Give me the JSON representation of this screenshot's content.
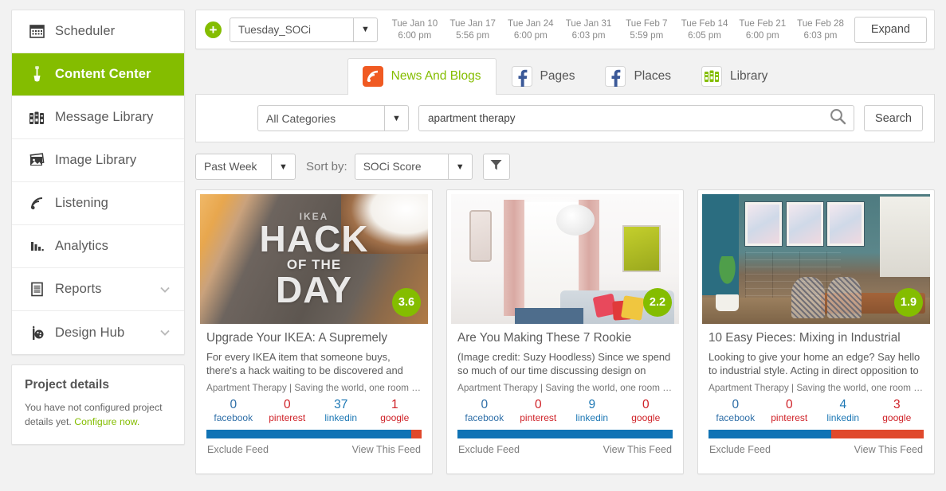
{
  "sidebar": {
    "items": [
      {
        "label": "Scheduler",
        "icon": "calendar-icon",
        "active": false,
        "expandable": false
      },
      {
        "label": "Content Center",
        "icon": "shovel-icon",
        "active": true,
        "expandable": false
      },
      {
        "label": "Message Library",
        "icon": "binders-icon",
        "active": false,
        "expandable": false
      },
      {
        "label": "Image Library",
        "icon": "photos-icon",
        "active": false,
        "expandable": false
      },
      {
        "label": "Listening",
        "icon": "rss-icon",
        "active": false,
        "expandable": false
      },
      {
        "label": "Analytics",
        "icon": "bar-chart-icon",
        "active": false,
        "expandable": false
      },
      {
        "label": "Reports",
        "icon": "document-icon",
        "active": false,
        "expandable": true
      },
      {
        "label": "Design Hub",
        "icon": "palette-brush-icon",
        "active": false,
        "expandable": true
      }
    ],
    "project_details": {
      "title": "Project details",
      "text": "You have not configured project details yet. ",
      "link": "Configure now."
    }
  },
  "toolbar": {
    "add_label": "+",
    "project_select": "Tuesday_SOCi",
    "expand_label": "Expand",
    "dates": [
      {
        "day": "Tue Jan 10",
        "time": "6:00 pm"
      },
      {
        "day": "Tue Jan 17",
        "time": "5:56 pm"
      },
      {
        "day": "Tue Jan 24",
        "time": "6:00 pm"
      },
      {
        "day": "Tue Jan 31",
        "time": "6:03 pm"
      },
      {
        "day": "Tue Feb 7",
        "time": "5:59 pm"
      },
      {
        "day": "Tue Feb 14",
        "time": "6:05 pm"
      },
      {
        "day": "Tue Feb 21",
        "time": "6:00 pm"
      },
      {
        "day": "Tue Feb 28",
        "time": "6:03 pm"
      }
    ]
  },
  "tabs": [
    {
      "label": "News And Blogs",
      "icon": "rss-square-icon",
      "active": true
    },
    {
      "label": "Pages",
      "icon": "facebook-icon",
      "active": false
    },
    {
      "label": "Places",
      "icon": "facebook-icon",
      "active": false
    },
    {
      "label": "Library",
      "icon": "binders-icon",
      "active": false
    }
  ],
  "search": {
    "category": "All Categories",
    "query": "apartment therapy",
    "placeholder": "",
    "search_button": "Search",
    "search_icon": "magnifier-icon"
  },
  "filters": {
    "period": "Past Week",
    "sort_label": "Sort by:",
    "sort_value": "SOCi Score",
    "funnel_icon": "funnel-icon"
  },
  "colors": {
    "accent_green": "#84bd00",
    "bar_blue": "#1073b5",
    "bar_red": "#e0492c",
    "facebook_blue": "#2f6fa8",
    "pinterest_red": "#cf2127",
    "linkedin_blue": "#1d78b5",
    "google_red": "#cf2127",
    "rss_orange": "#f05a22"
  },
  "stat_labels": [
    "facebook",
    "pinterest",
    "linkedin",
    "google"
  ],
  "card_footer": {
    "exclude": "Exclude Feed",
    "view": "View This Feed"
  },
  "cards": [
    {
      "image": "ikea-hack-of-the-day-dresser",
      "image_text": {
        "l1": "IKEA",
        "l2": "HACK",
        "l3": "OF THE",
        "l4": "DAY"
      },
      "score": "3.6",
      "title": "Upgrade Your IKEA: A Supremely",
      "description": "For every IKEA item that someone buys, there's a hack waiting to be discovered and then made.",
      "source": "Apartment Therapy | Saving the world, one room at a...",
      "stats": {
        "facebook": "0",
        "pinterest": "0",
        "linkedin": "37",
        "google": "1"
      },
      "bar": {
        "blue_pct": 95,
        "red_pct": 5
      }
    },
    {
      "image": "white-living-room-pink-curtains",
      "score": "2.2",
      "title": "Are You Making These 7 Rookie",
      "description": "(Image credit: Suzy Hoodless) Since we spend so much of our time discussing design on",
      "source": "Apartment Therapy | Saving the world, one room at a...",
      "stats": {
        "facebook": "0",
        "pinterest": "0",
        "linkedin": "9",
        "google": "0"
      },
      "bar": {
        "blue_pct": 100,
        "red_pct": 0
      }
    },
    {
      "image": "teal-dining-room-posters",
      "score": "1.9",
      "title": "10 Easy Pieces: Mixing in Industrial",
      "description": "Looking to give your home an edge? Say hello to industrial style. Acting in direct opposition to",
      "source": "Apartment Therapy | Saving the world, one room at a...",
      "stats": {
        "facebook": "0",
        "pinterest": "0",
        "linkedin": "4",
        "google": "3"
      },
      "bar": {
        "blue_pct": 57,
        "red_pct": 43
      }
    }
  ]
}
